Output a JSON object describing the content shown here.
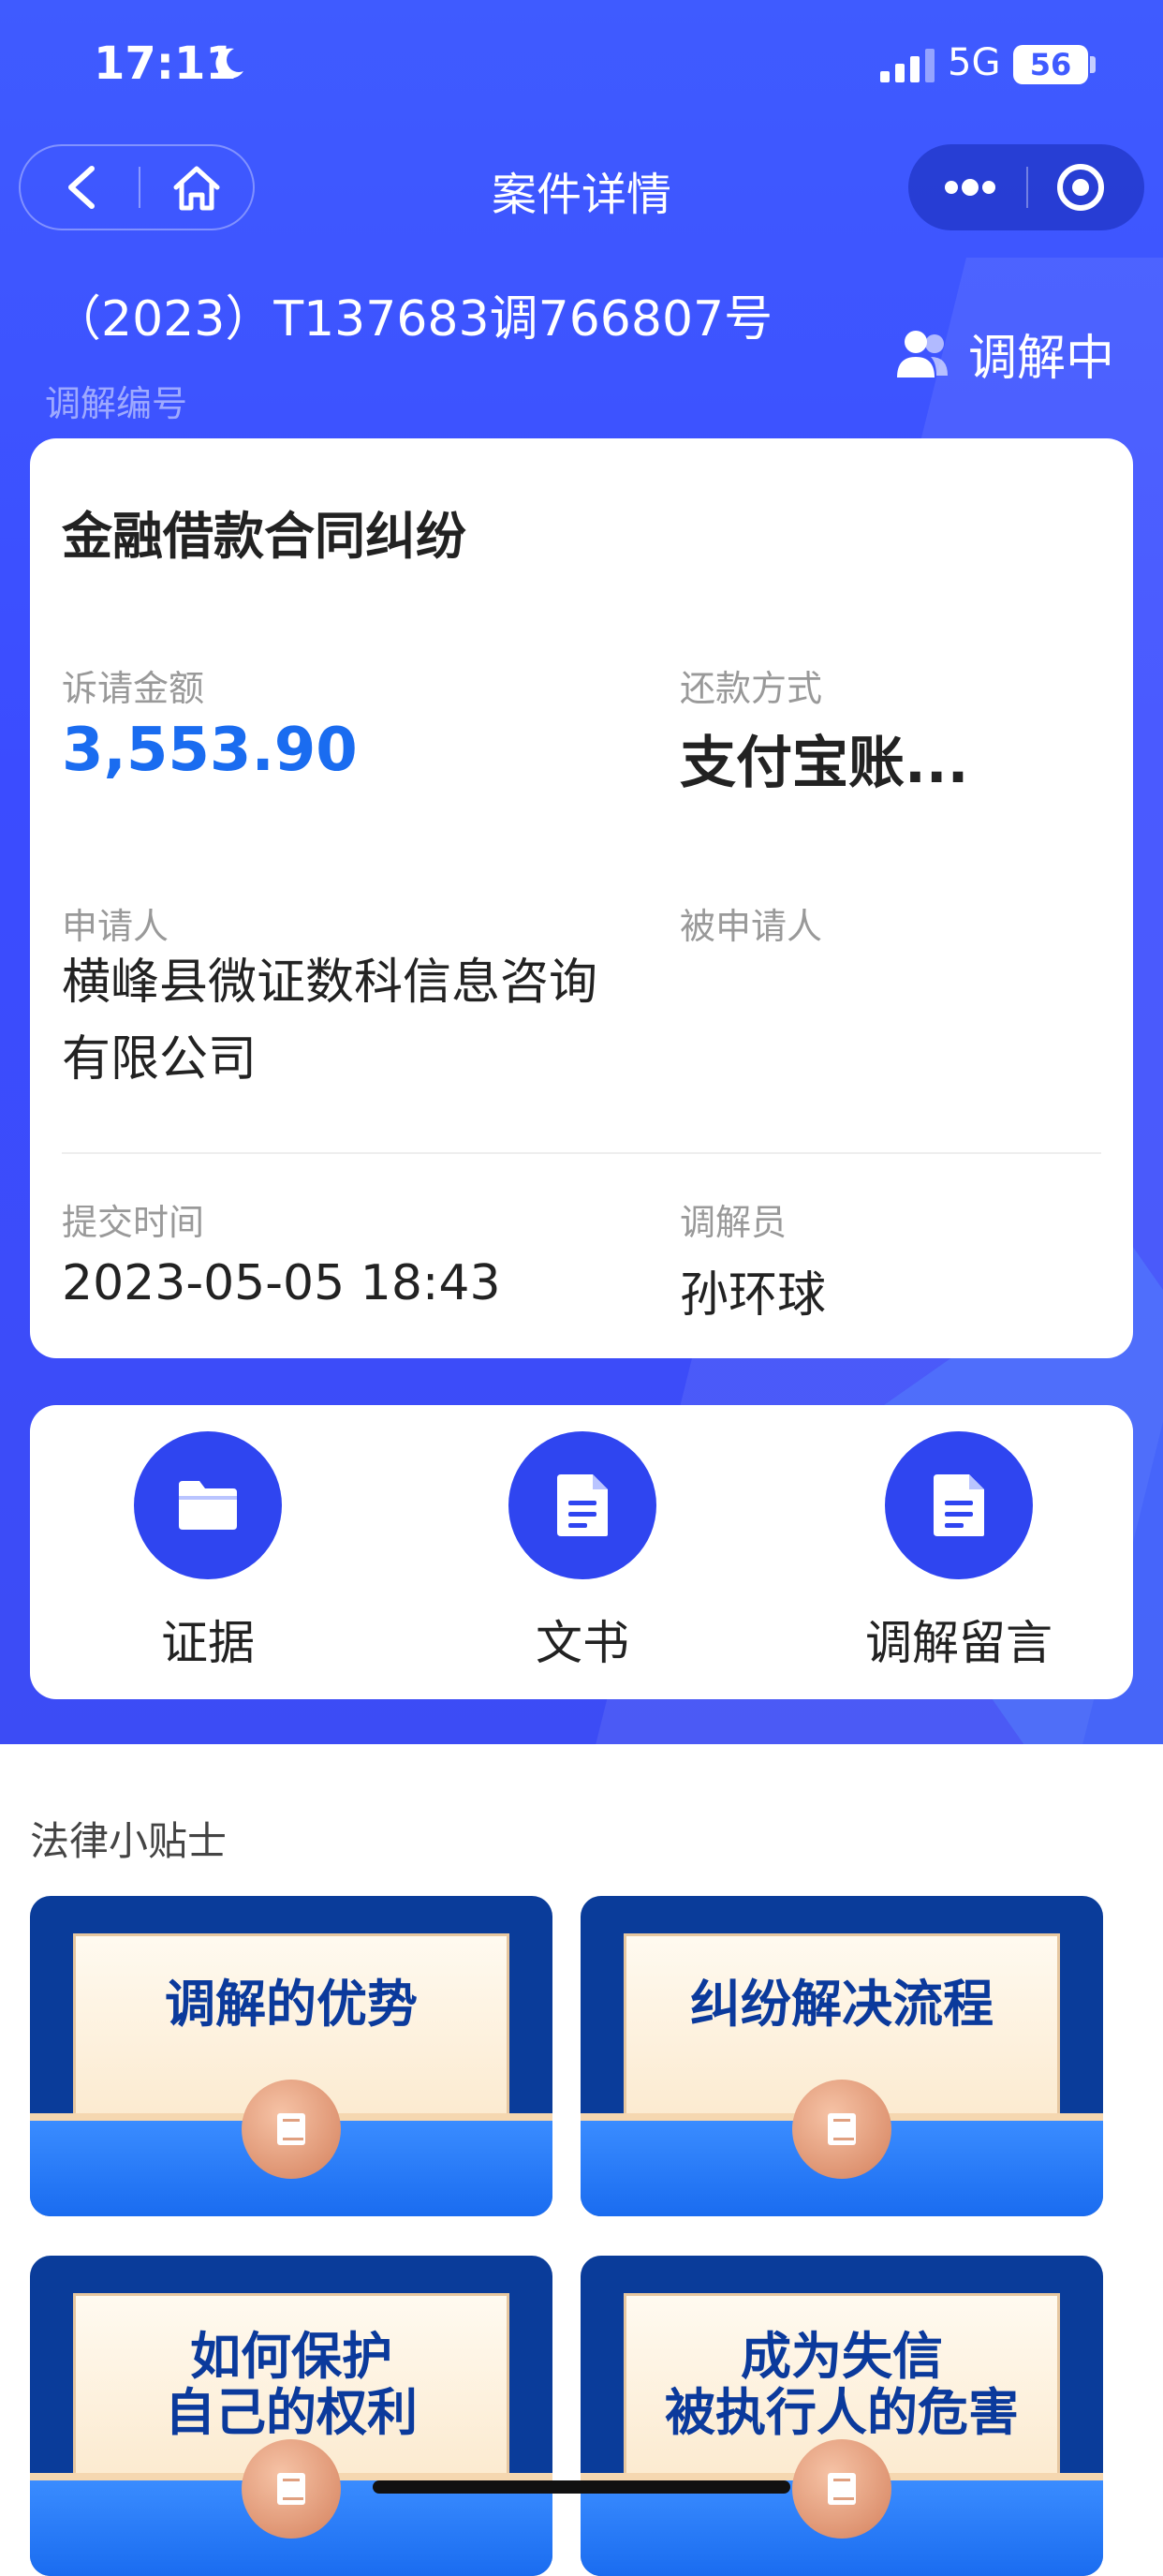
{
  "status_bar": {
    "time": "17:11",
    "network": "5G",
    "battery": "56"
  },
  "nav": {
    "title": "案件详情"
  },
  "case": {
    "number": "（2023）T137683调766807号",
    "number_label": "调解编号",
    "status": "调解中",
    "type": "金融借款合同纠纷",
    "amount_label": "诉请金额",
    "amount": "3,553.90",
    "repay_label": "还款方式",
    "repay": "支付宝账...",
    "applicant_label": "申请人",
    "applicant": "横峰县微证数科信息咨询有限公司",
    "respondent_label": "被申请人",
    "respondent": "",
    "submit_label": "提交时间",
    "submit_time": "2023-05-05 18:43",
    "mediator_label": "调解员",
    "mediator": "孙环球"
  },
  "actions": [
    {
      "label": "证据",
      "icon": "folder-icon"
    },
    {
      "label": "文书",
      "icon": "document-icon"
    },
    {
      "label": "调解留言",
      "icon": "message-document-icon"
    }
  ],
  "tips": {
    "title": "法律小贴士",
    "items": [
      {
        "line1": "调解的优势",
        "line2": ""
      },
      {
        "line1": "纠纷解决流程",
        "line2": ""
      },
      {
        "line1": "如何保护",
        "line2": "自己的权利"
      },
      {
        "line1": "成为失信",
        "line2": "被执行人的危害"
      }
    ]
  },
  "colors": {
    "primary": "#3f5bff",
    "amount": "#1a6cf0",
    "action_circle": "#2f45f0"
  }
}
